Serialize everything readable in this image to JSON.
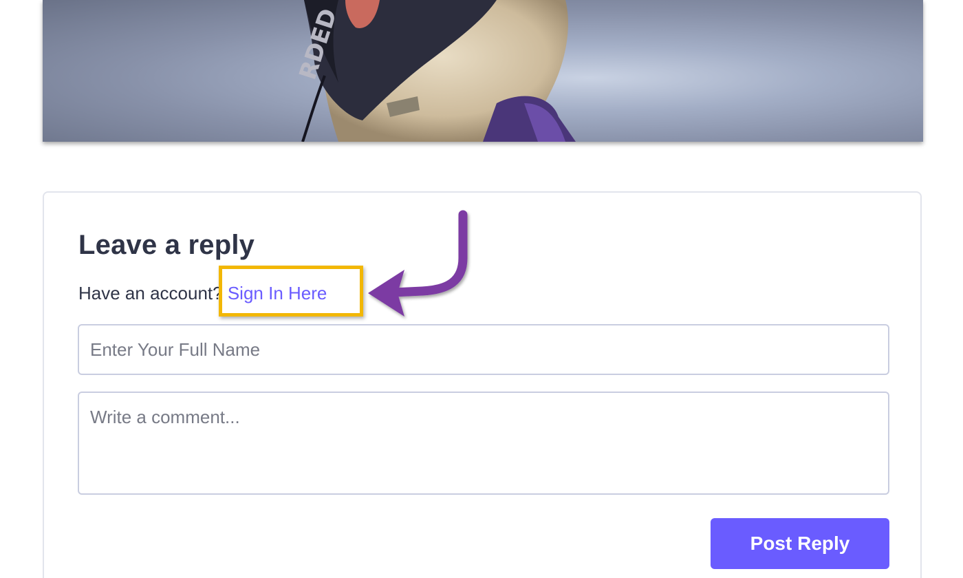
{
  "hero": {
    "image_icon": "dog-with-bandana-photo",
    "bandana_text": "RDED"
  },
  "reply": {
    "title": "Leave a reply",
    "account_prompt": "Have an account?",
    "signin_link": "Sign In Here",
    "name_placeholder": "Enter Your Full Name",
    "comment_placeholder": "Write a comment...",
    "post_button": "Post Reply"
  },
  "annotations": {
    "highlight_color": "#f2b705",
    "arrow_color": "#7b3aa3",
    "arrow_icon": "curved-arrow-icon"
  },
  "colors": {
    "accent": "#6a5cff",
    "text": "#2f3447",
    "border": "#c9cde0"
  }
}
